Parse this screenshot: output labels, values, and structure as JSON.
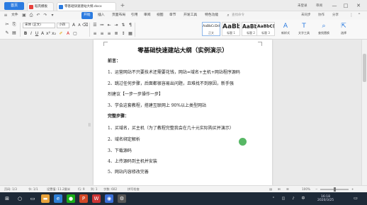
{
  "titlebar": {
    "home_tab": "首页",
    "tabs": [
      {
        "label": "稻壳模板"
      },
      {
        "label": "零基础快速建站大纲.docx"
      }
    ],
    "add_tab": "+",
    "user_items": [
      "未登录",
      "审阅"
    ],
    "window_controls": [
      "—",
      "□",
      "✕"
    ]
  },
  "menubar": {
    "items": [
      "文件",
      "开始",
      "插入",
      "页面布局",
      "引用",
      "审阅",
      "视图",
      "章节",
      "开发工具",
      "特色功能"
    ],
    "active": "开始",
    "search_placeholder": "查找命令",
    "right_items": [
      "未同步",
      "协作",
      "分享"
    ]
  },
  "ribbon": {
    "font_name": "宋体 (正文)",
    "font_size": "小四",
    "styles": [
      {
        "sample": "AaBbCcDd",
        "name": "正文"
      },
      {
        "sample": "AaBb",
        "name": "标题 1"
      },
      {
        "sample": "AaBb(",
        "name": "标题 2"
      },
      {
        "sample": "AaBbC(",
        "name": "标题 3"
      }
    ],
    "big_buttons": [
      {
        "icon": "A",
        "label": "新样式"
      },
      {
        "icon": "T",
        "label": "文字工具"
      },
      {
        "icon": "⌕",
        "label": "查找替换"
      },
      {
        "icon": "⇱",
        "label": "选择"
      }
    ]
  },
  "document": {
    "title": "零基础快速建站大纲（实例演示）",
    "lines": [
      {
        "text": "前言：",
        "heading": true
      },
      {
        "text": "1、运营网站不只要技术还需要花钱，网站=域名+主机+网站程序源码",
        "heading": false
      },
      {
        "text": "2、跳过任何步骤，后面都很容易出问题，且难找不到原因，新手强",
        "heading": false
      },
      {
        "text": "烈建议【一步一步操作一步】",
        "heading": false
      },
      {
        "text": "3、学会这套教程，搭建互联网上 90%以上类型网站",
        "heading": false
      },
      {
        "text": "完整步骤：",
        "heading": true
      },
      {
        "text": "1、买域名，买主机（为了教程完整我会在几十元实际购买并演示）",
        "heading": false
      },
      {
        "text": "2、域名绑定解析",
        "heading": false
      },
      {
        "text": "3、下载源码",
        "heading": false
      },
      {
        "text": "4、上传源码到主机并安装",
        "heading": false
      },
      {
        "text": "5、网站内容修改完善",
        "heading": false
      }
    ]
  },
  "statusbar": {
    "page": "页码: 1/3",
    "section": "节: 1/1",
    "settings": "设置值: 11.2厘米",
    "row": "行: 9",
    "col": "列: 1",
    "words": "字数: 602",
    "spell": "拼写检查",
    "zoom": "100%",
    "zoom_fraction": 0.5
  },
  "taskbar": {
    "time": "16:18",
    "date": "2020/3/25"
  },
  "colors": {
    "accent": "#2b7be0",
    "cursor_highlight": "#3aaa4a"
  }
}
